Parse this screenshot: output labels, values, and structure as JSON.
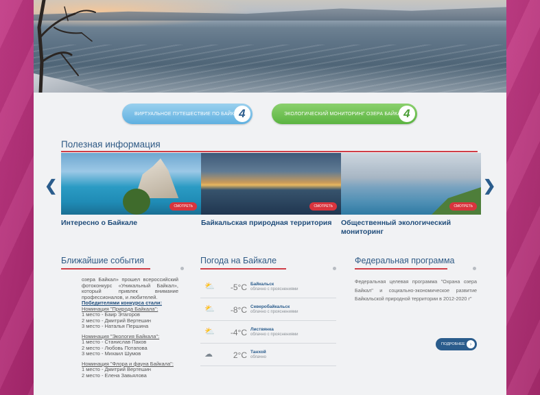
{
  "nav": {
    "virtual_tour": {
      "label": "Виртуальное путешествие по Байкалу",
      "num": "4"
    },
    "eco_monitoring": {
      "label": "Экологический мониторинг озера Байкал",
      "num": "4"
    }
  },
  "info": {
    "title": "Полезная информация",
    "prev_icon": "chevron-left-icon",
    "next_icon": "chevron-right-icon",
    "cards": [
      {
        "label": "Интересно о Байкале",
        "button": "смотреть"
      },
      {
        "label": "Байкальская природная территория",
        "button": "смотреть"
      },
      {
        "label": "Общественный экологический мониторинг",
        "button": "смотреть"
      }
    ]
  },
  "events": {
    "title": "Ближайшие события",
    "intro": "озера Байкал» прошел всероссийский фотоконкурс «Уникальный Байкал», который привлек внимание профессионалов, и любителей.",
    "winners_heading": "Победителями конкурса стали:",
    "nom1": "Номинация \"Природа Байкала\":",
    "nom1_lines": [
      "1 место - Баир Этагоров",
      "2 место - Дмитрий Вертешин",
      "3 место - Наталья Першина"
    ],
    "nom2": "Номинация \"Экология Байкала\":",
    "nom2_lines": [
      "1 место - Станислав Паков",
      "2 место - Любовь Потапова",
      "3 место - Михаил Шумов"
    ],
    "nom3": "Номинация \"Флора и фауна Байкала\":",
    "nom3_lines": [
      "1 место - Дмитрий Вертешин",
      "2 место - Елена Завьялова"
    ]
  },
  "weather": {
    "title": "Погода на Байкале",
    "rows": [
      {
        "icon": "partly-cloudy-icon",
        "temp": "-5°C",
        "city": "Байкальск",
        "desc": "облачно с прояснениями"
      },
      {
        "icon": "partly-cloudy-icon",
        "temp": "-8°C",
        "city": "Северобайкальск",
        "desc": "облачно с прояснениями"
      },
      {
        "icon": "partly-cloudy-icon",
        "temp": "-4°C",
        "city": "Листвянка",
        "desc": "облачно с прояснениями"
      },
      {
        "icon": "cloud-icon",
        "temp": "2°C",
        "city": "Танхой",
        "desc": "облачно"
      }
    ]
  },
  "federal": {
    "title": "Федеральная программа",
    "text": "Федеральная целевая программа \"Охрана озера Байкал\" и социально-экономическое развитие Байкальской природной территории в 2012-2020 г\"",
    "more_label": "подробнее",
    "more_icon": "arrow-right-icon"
  },
  "colors": {
    "accent_red": "#cf3c45",
    "link_blue": "#2a5c8c",
    "pill_blue": "#5fb0e0",
    "pill_green": "#5bb441"
  }
}
